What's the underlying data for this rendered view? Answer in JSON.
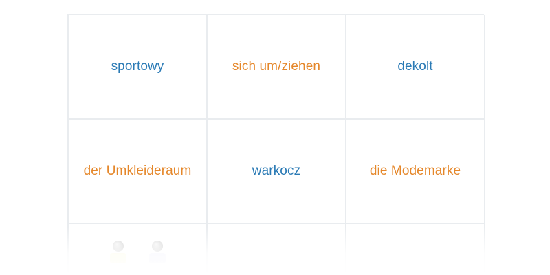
{
  "cards": [
    {
      "text": "sportowy",
      "lang": "pl",
      "color": "#2a7ab5"
    },
    {
      "text": "sich um/ziehen",
      "lang": "de",
      "color": "#e5872a"
    },
    {
      "text": "dekolt",
      "lang": "pl",
      "color": "#2a7ab5"
    },
    {
      "text": "der Umkleideraum",
      "lang": "de",
      "color": "#e5872a"
    },
    {
      "text": "warkocz",
      "lang": "pl",
      "color": "#2a7ab5"
    },
    {
      "text": "die Modemarke",
      "lang": "de",
      "color": "#e5872a"
    }
  ],
  "colors": {
    "polish": "#2a7ab5",
    "german": "#e5872a",
    "border": "#e9ecef"
  },
  "icons": [
    "user-avatar-icon",
    "user-avatar-icon"
  ]
}
